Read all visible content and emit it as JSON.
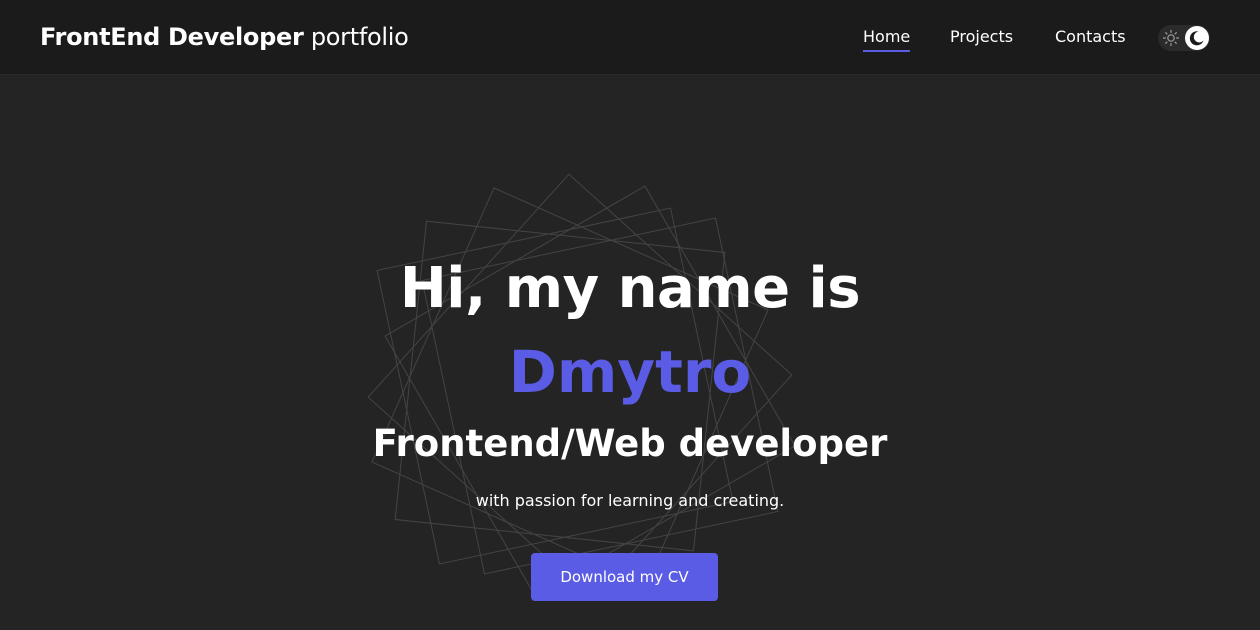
{
  "header": {
    "brand_bold": "FrontEnd Developer",
    "brand_light": "portfolio",
    "nav": {
      "home": "Home",
      "projects": "Projects",
      "contacts": "Contacts"
    },
    "active_nav": "Home",
    "theme": "dark",
    "theme_icons": [
      "sun-icon",
      "moon-icon"
    ]
  },
  "hero": {
    "greeting": "Hi, my name is",
    "name": "Dmytro",
    "role": "Frontend/Web developer",
    "tagline": "with passion for learning and creating.",
    "cta_label": "Download my CV"
  },
  "colors": {
    "accent": "#5a5ce6",
    "header_bg": "#1b1b1b",
    "page_bg": "#242424",
    "text": "#ffffff"
  }
}
